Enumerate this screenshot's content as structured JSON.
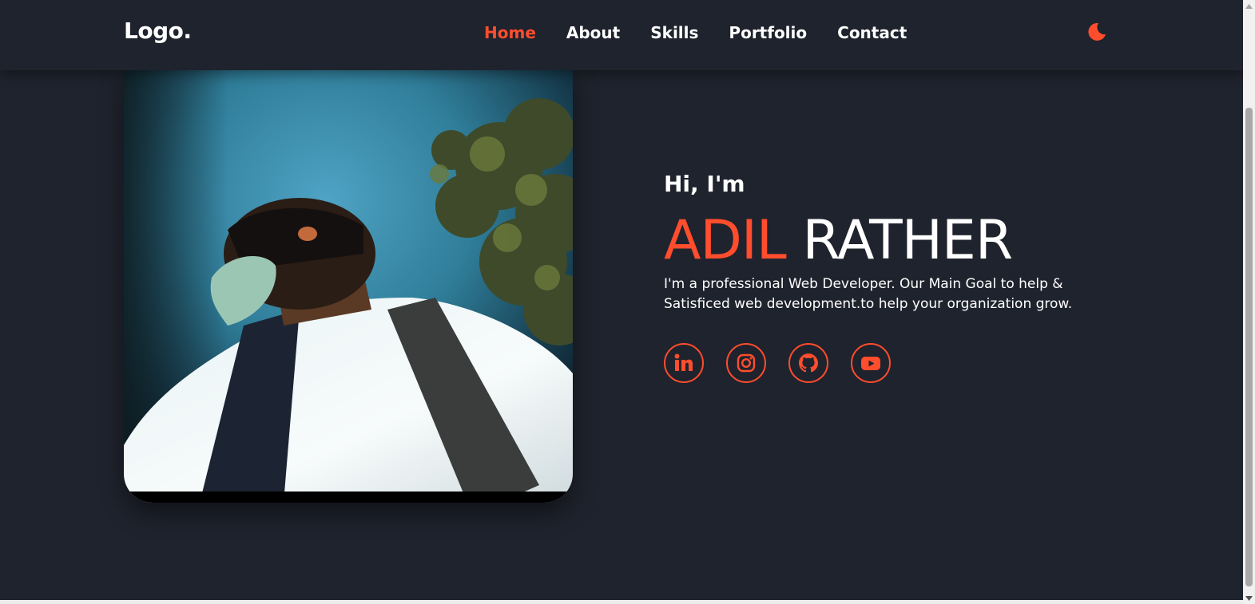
{
  "header": {
    "logo": "Logo.",
    "nav": [
      {
        "label": "Home",
        "active": true
      },
      {
        "label": "About",
        "active": false
      },
      {
        "label": "Skills",
        "active": false
      },
      {
        "label": "Portfolio",
        "active": false
      },
      {
        "label": "Contact",
        "active": false
      }
    ],
    "theme_toggle_icon": "moon-icon"
  },
  "hero": {
    "greeting": "Hi, I'm",
    "first_name": "ADIL",
    "last_name": "RATHER",
    "description": "I'm a professional Web Developer. Our Main Goal to help & Satisficed web development.to help your organization grow.",
    "socials": [
      {
        "icon": "linkedin-icon"
      },
      {
        "icon": "instagram-icon"
      },
      {
        "icon": "github-icon"
      },
      {
        "icon": "youtube-icon"
      }
    ]
  },
  "colors": {
    "background": "#1f232d",
    "accent": "#ff4d2d",
    "text": "#ffffff"
  }
}
